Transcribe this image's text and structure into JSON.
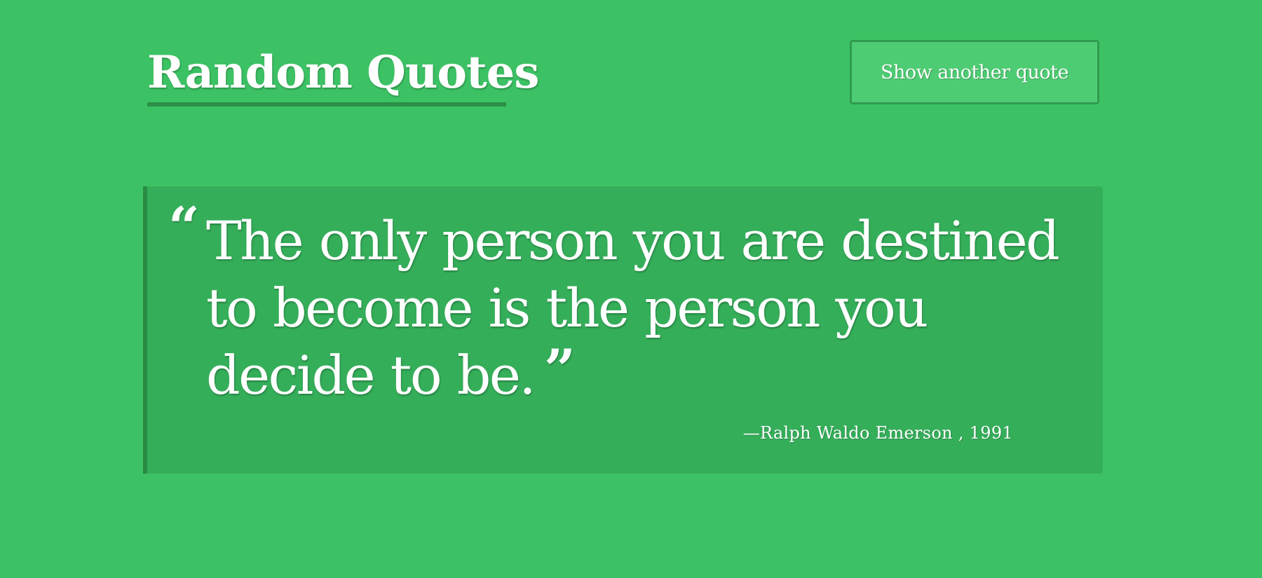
{
  "header": {
    "title": "Random Quotes",
    "button_label": "Show another quote"
  },
  "quote": {
    "open_mark": "“",
    "text": "The only person you are destined to become is the person you decide to be.",
    "close_mark": "”",
    "attribution": "—Ralph Waldo Emerson , 1991"
  },
  "colors": {
    "background": "#3cc264",
    "card": "#35ae5a",
    "accent_dark": "#2a8a44",
    "button": "#4ecc73",
    "text": "#ffffff"
  }
}
